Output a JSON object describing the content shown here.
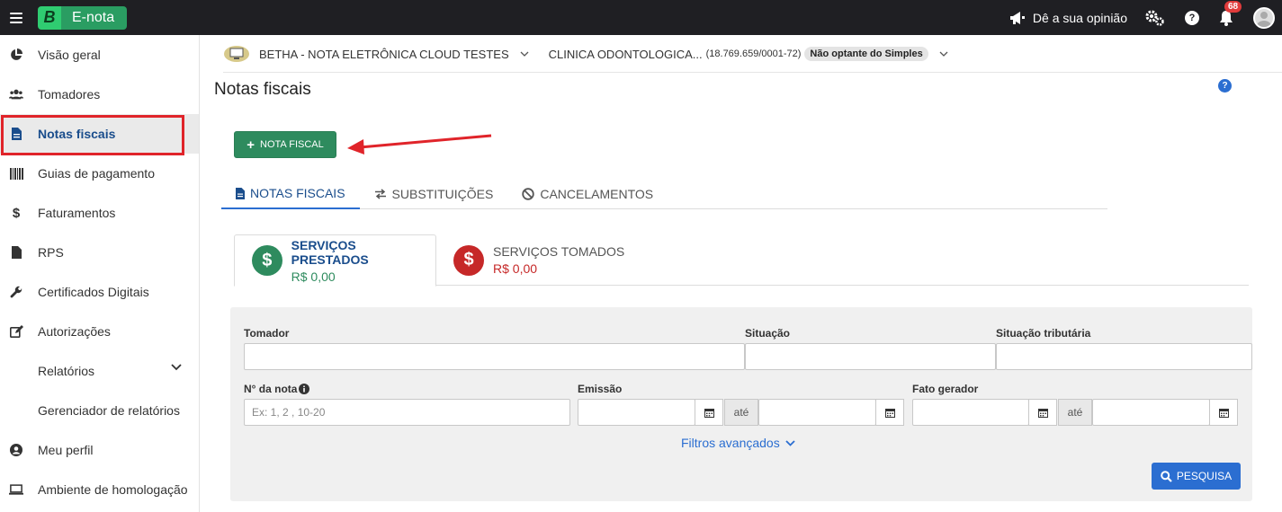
{
  "topbar": {
    "logo_letter": "B",
    "logo_text": "E-nota",
    "opinion_label": "Dê a sua opinião",
    "help_glyph": "?",
    "notification_count": "68"
  },
  "sidebar": {
    "items": [
      {
        "label": "Visão geral",
        "icon": "pie-chart-icon"
      },
      {
        "label": "Tomadores",
        "icon": "users-icon"
      },
      {
        "label": "Notas fiscais",
        "icon": "document-icon"
      },
      {
        "label": "Guias de pagamento",
        "icon": "barcode-icon"
      },
      {
        "label": "Faturamentos",
        "icon": "dollar-icon"
      },
      {
        "label": "RPS",
        "icon": "file-icon"
      },
      {
        "label": "Certificados Digitais",
        "icon": "wrench-icon"
      },
      {
        "label": "Autorizações",
        "icon": "edit-icon"
      },
      {
        "label": "Relatórios",
        "icon": ""
      },
      {
        "label": "Gerenciador de relatórios",
        "icon": ""
      },
      {
        "label": "Meu perfil",
        "icon": "user-circle-icon"
      },
      {
        "label": "Ambiente de homologação",
        "icon": "laptop-icon"
      }
    ]
  },
  "entity": {
    "system": "BETHA - NOTA ELETRÔNICA CLOUD TESTES",
    "company": "CLINICA ODONTOLOGICA...",
    "cnpj": "(18.769.659/0001-72)",
    "regime": "Não optante do Simples"
  },
  "page": {
    "title": "Notas fiscais",
    "help_glyph": "?",
    "new_button": "NOTA FISCAL"
  },
  "tabs": [
    {
      "label": "NOTAS FISCAIS"
    },
    {
      "label": "SUBSTITUIÇÕES"
    },
    {
      "label": "CANCELAMENTOS"
    }
  ],
  "services": {
    "prestados": {
      "title": "SERVIÇOS PRESTADOS",
      "amount": "R$ 0,00",
      "color": "#2e8b5e"
    },
    "tomados": {
      "title": "SERVIÇOS TOMADOS",
      "amount": "R$ 0,00",
      "color": "#c62828"
    }
  },
  "filters": {
    "tomador_label": "Tomador",
    "situacao_label": "Situação",
    "situacao_trib_label": "Situação tributária",
    "numero_label": "N° da nota",
    "numero_placeholder": "Ex: 1, 2 , 10-20",
    "emissao_label": "Emissão",
    "fato_label": "Fato gerador",
    "ate_label": "até",
    "advanced_label": "Filtros avançados",
    "search_button": "PESQUISA"
  },
  "colors": {
    "accent": "#2b6ed1",
    "primary_green": "#2e8b5e",
    "highlight_red": "#e0242a",
    "topbar": "#1f1f23"
  }
}
